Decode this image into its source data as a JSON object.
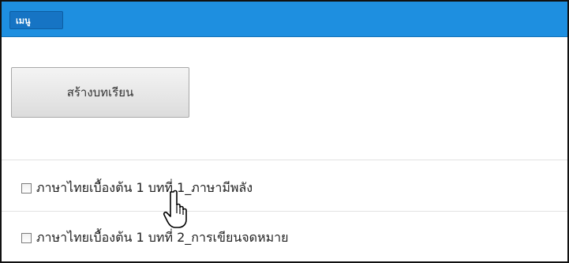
{
  "header": {
    "menu_label": "เมนู"
  },
  "toolbar": {
    "create_lesson_label": "สร้างบทเรียน"
  },
  "lessons": [
    {
      "label": "ภาษาไทยเบื้องต้น 1 บทที่ 1_ภาษามีพลัง",
      "checked": false
    },
    {
      "label": "ภาษาไทยเบื้องต้น 1 บทที่ 2_การเขียนจดหมาย",
      "checked": false
    }
  ],
  "colors": {
    "topbar": "#1e8fe0",
    "menu_button": "#1674c4"
  },
  "cursor": "hand-pointer-icon"
}
